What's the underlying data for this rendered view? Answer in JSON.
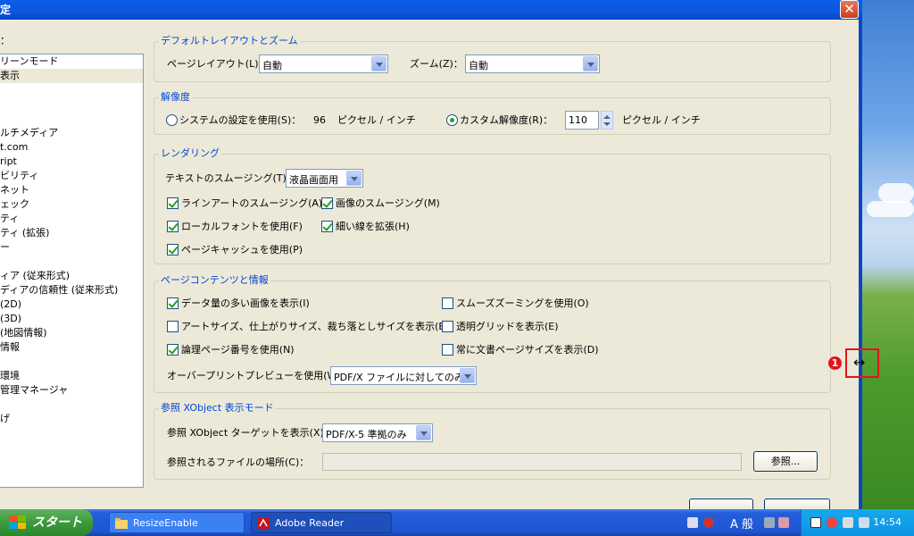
{
  "window": {
    "title": "定",
    "close_label": "✕"
  },
  "categories": {
    "label": "：",
    "items": [
      "リーンモード",
      "表示",
      "",
      "",
      "",
      "ルチメディア",
      "t.com",
      "ript",
      "ビリティ",
      "ネット",
      "ェック",
      "ティ",
      "ティ (拡張)",
      "ー",
      "",
      "ィア (従来形式)",
      "ディアの信頼性 (従来形式)",
      "(2D)",
      "(3D)",
      "(地図情報)",
      "情報",
      "",
      "環境",
      "管理マネージャ",
      "",
      "げ"
    ],
    "selected_index": 1
  },
  "layout_zoom": {
    "title": "デフォルトレイアウトとズーム",
    "page_layout_label": "ページレイアウト(L)：",
    "page_layout_value": "自動",
    "zoom_label": "ズーム(Z)：",
    "zoom_value": "自動"
  },
  "resolution": {
    "title": "解像度",
    "system_label": "システムの設定を使用(S)：",
    "system_value": "96",
    "system_unit": "ピクセル / インチ",
    "custom_label": "カスタム解像度(R)：",
    "custom_value": "110",
    "custom_unit": "ピクセル / インチ",
    "selected": "custom"
  },
  "rendering": {
    "title": "レンダリング",
    "smoothing_label": "テキストのスムージング(T)：",
    "smoothing_value": "液晶画面用",
    "checkboxes": {
      "lineart": {
        "label": "ラインアートのスムージング(A)",
        "checked": true
      },
      "image": {
        "label": "画像のスムージング(M)",
        "checked": true
      },
      "localfont": {
        "label": "ローカルフォントを使用(F)",
        "checked": true
      },
      "thinlines": {
        "label": "細い線を拡張(H)",
        "checked": true
      },
      "pagecache": {
        "label": "ページキャッシュを使用(P)",
        "checked": true
      }
    }
  },
  "content": {
    "title": "ページコンテンツと情報",
    "checkboxes": {
      "largeimages": {
        "label": "データ量の多い画像を表示(I)",
        "checked": true
      },
      "smoothzoom": {
        "label": "スムーズズーミングを使用(O)",
        "checked": false
      },
      "artsize": {
        "label": "アートサイズ、仕上がりサイズ、裁ち落としサイズを表示(B)",
        "checked": false
      },
      "transgrid": {
        "label": "透明グリッドを表示(E)",
        "checked": false
      },
      "logicalpage": {
        "label": "論理ページ番号を使用(N)",
        "checked": true
      },
      "docsize": {
        "label": "常に文書ページサイズを表示(D)",
        "checked": false
      }
    },
    "overprint_label": "オーバープリントプレビューを使用(W)：",
    "overprint_value": "PDF/X ファイルに対してのみ"
  },
  "xobject": {
    "title": "参照 XObject 表示モード",
    "target_label": "参照 XObject ターゲットを表示(X)：",
    "target_value": "PDF/X-5 準拠のみ",
    "location_label": "参照されるファイルの場所(C)：",
    "location_value": "",
    "browse_label": "参照..."
  },
  "annotation": {
    "marker": "1",
    "arrow": "↔"
  },
  "taskbar": {
    "start_label": "スタート",
    "tasks": [
      {
        "label": "ResizeEnable",
        "active": false
      },
      {
        "label": "Adobe Reader",
        "active": true
      }
    ],
    "lang": "A 般",
    "clock": "14:54"
  },
  "colors": {
    "accent": "#0046d5",
    "title_bar": "#0a5ee8",
    "marker_red": "#e2141a",
    "check_green": "#21a121"
  }
}
